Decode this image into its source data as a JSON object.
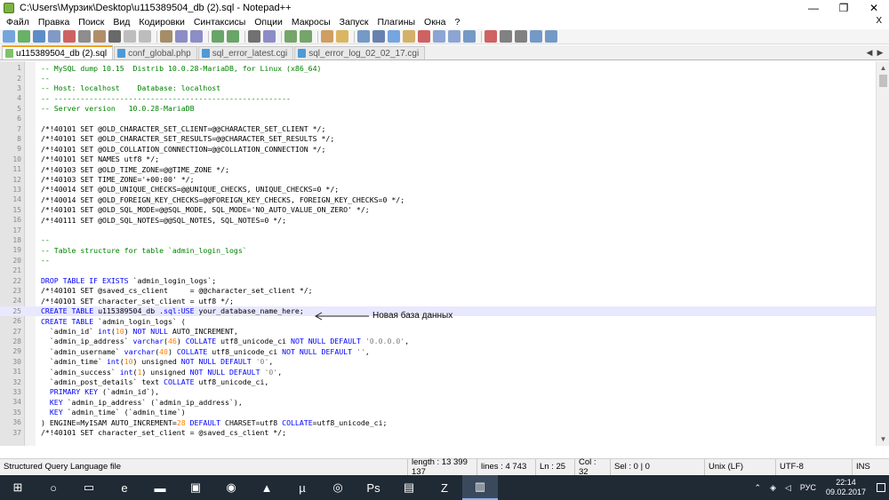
{
  "window": {
    "title": "C:\\Users\\Мурзик\\Desktop\\u115389504_db (2).sql - Notepad++",
    "minimize": "—",
    "maximize": "❐",
    "close": "✕"
  },
  "menu": [
    "Файл",
    "Правка",
    "Поиск",
    "Вид",
    "Кодировки",
    "Синтаксисы",
    "Опции",
    "Макросы",
    "Запуск",
    "Плагины",
    "Окна",
    "?"
  ],
  "menu_close": "X",
  "tabs": [
    {
      "label": "u115389504_db (2).sql",
      "active": true
    },
    {
      "label": "conf_global.php",
      "active": false
    },
    {
      "label": "sql_error_latest.cgi",
      "active": false
    },
    {
      "label": "sql_error_log_02_02_17.cgi",
      "active": false
    }
  ],
  "tab_scroll": {
    "left": "◀",
    "right": "▶"
  },
  "scrollbar": {
    "up": "▲",
    "down": "▼"
  },
  "lines": [
    {
      "n": "1",
      "html": "<span class='cm'>-- MySQL dump 10.15  Distrib 10.0.28-MariaDB, for Linux (x86_64)</span>"
    },
    {
      "n": "2",
      "html": "<span class='cm'>--</span>"
    },
    {
      "n": "3",
      "html": "<span class='cm'>-- Host: localhost    Database: localhost</span>"
    },
    {
      "n": "4",
      "html": "<span class='cm'>-- ------------------------------------------------------</span>"
    },
    {
      "n": "5",
      "html": "<span class='cm'>-- Server version   10.0.28-MariaDB</span>"
    },
    {
      "n": "6",
      "html": ""
    },
    {
      "n": "7",
      "html": "/*!40101 SET @OLD_CHARACTER_SET_CLIENT=@@CHARACTER_SET_CLIENT */;"
    },
    {
      "n": "8",
      "html": "/*!40101 SET @OLD_CHARACTER_SET_RESULTS=@@CHARACTER_SET_RESULTS */;"
    },
    {
      "n": "9",
      "html": "/*!40101 SET @OLD_COLLATION_CONNECTION=@@COLLATION_CONNECTION */;"
    },
    {
      "n": "10",
      "html": "/*!40101 SET NAMES utf8 */;"
    },
    {
      "n": "11",
      "html": "/*!40103 SET @OLD_TIME_ZONE=@@TIME_ZONE */;"
    },
    {
      "n": "12",
      "html": "/*!40103 SET TIME_ZONE='+00:00' */;"
    },
    {
      "n": "13",
      "html": "/*!40014 SET @OLD_UNIQUE_CHECKS=@@UNIQUE_CHECKS, UNIQUE_CHECKS=0 */;"
    },
    {
      "n": "14",
      "html": "/*!40014 SET @OLD_FOREIGN_KEY_CHECKS=@@FOREIGN_KEY_CHECKS, FOREIGN_KEY_CHECKS=0 */;"
    },
    {
      "n": "15",
      "html": "/*!40101 SET @OLD_SQL_MODE=@@SQL_MODE, SQL_MODE='NO_AUTO_VALUE_ON_ZERO' */;"
    },
    {
      "n": "16",
      "html": "/*!40111 SET @OLD_SQL_NOTES=@@SQL_NOTES, SQL_NOTES=0 */;"
    },
    {
      "n": "17",
      "html": ""
    },
    {
      "n": "18",
      "html": "<span class='cm'>--</span>"
    },
    {
      "n": "19",
      "html": "<span class='cm'>-- Table structure for table `admin_login_logs`</span>"
    },
    {
      "n": "20",
      "html": "<span class='cm'>--</span>"
    },
    {
      "n": "21",
      "html": ""
    },
    {
      "n": "22",
      "html": "<span class='kw'>DROP TABLE IF EXISTS</span> `admin_login_logs`;"
    },
    {
      "n": "23",
      "html": "/*!40101 SET @saved_cs_client     = @@character_set_client */;"
    },
    {
      "n": "24",
      "html": "/*!40101 SET character_set_client = utf8 */;"
    },
    {
      "n": "25",
      "html": "<span class='kw'>CREATE TABLE</span> u115389504_db <span class='kw'>.sql:USE</span> your_database_name_here;"
    },
    {
      "n": "26",
      "html": "<span class='kw'>CREATE TABLE</span> `admin_login_logs` ("
    },
    {
      "n": "27",
      "html": "  `admin_id` <span class='kw'>int</span>(<span class='nm'>10</span>) <span class='kw'>NOT NULL</span> AUTO_INCREMENT,"
    },
    {
      "n": "28",
      "html": "  `admin_ip_address` <span class='kw'>varchar</span>(<span class='nm'>46</span>) <span class='kw'>COLLATE</span> utf8_unicode_ci <span class='kw'>NOT NULL DEFAULT</span> <span class='st'>'0.0.0.0'</span>,"
    },
    {
      "n": "29",
      "html": "  `admin_username` <span class='kw'>varchar</span>(<span class='nm'>40</span>) <span class='kw'>COLLATE</span> utf8_unicode_ci <span class='kw'>NOT NULL DEFAULT</span> <span class='st'>''</span>,"
    },
    {
      "n": "30",
      "html": "  `admin_time` <span class='kw'>int</span>(<span class='nm'>10</span>) unsigned <span class='kw'>NOT NULL DEFAULT</span> <span class='st'>'0'</span>,"
    },
    {
      "n": "31",
      "html": "  `admin_success` <span class='kw'>int</span>(<span class='nm'>1</span>) unsigned <span class='kw'>NOT NULL DEFAULT</span> <span class='st'>'0'</span>,"
    },
    {
      "n": "32",
      "html": "  `admin_post_details` text <span class='kw'>COLLATE</span> utf8_unicode_ci,"
    },
    {
      "n": "33",
      "html": "  <span class='kw'>PRIMARY KEY</span> (`admin_id`),"
    },
    {
      "n": "34",
      "html": "  <span class='kw'>KEY</span> `admin_ip_address` (`admin_ip_address`),"
    },
    {
      "n": "35",
      "html": "  <span class='kw'>KEY</span> `admin_time` (`admin_time`)"
    },
    {
      "n": "36",
      "html": ") ENGINE=MyISAM AUTO_INCREMENT=<span class='nm'>28</span> <span class='kw'>DEFAULT</span> CHARSET=utf8 <span class='kw'>COLLATE</span>=utf8_unicode_ci;"
    },
    {
      "n": "37",
      "html": "/*!40101 SET character_set_client = @saved_cs_client */;"
    }
  ],
  "annotation": "Новая база данных",
  "status": {
    "type": "Structured Query Language file",
    "length": "length : 13 399 137",
    "lines": "lines : 4 743",
    "ln": "Ln : 25",
    "col": "Col : 32",
    "sel": "Sel : 0 | 0",
    "eol": "Unix (LF)",
    "encoding": "UTF-8",
    "mode": "INS"
  },
  "taskbar": {
    "apps": [
      "windows-start",
      "search",
      "task-view",
      "edge",
      "explorer",
      "store",
      "chrome",
      "vlc",
      "utorrent",
      "steam",
      "photoshop",
      "notepad",
      "filezilla",
      "notepad-plus-plus"
    ],
    "lang": "РУС",
    "time": "22:14",
    "date": "09.02.2017"
  }
}
